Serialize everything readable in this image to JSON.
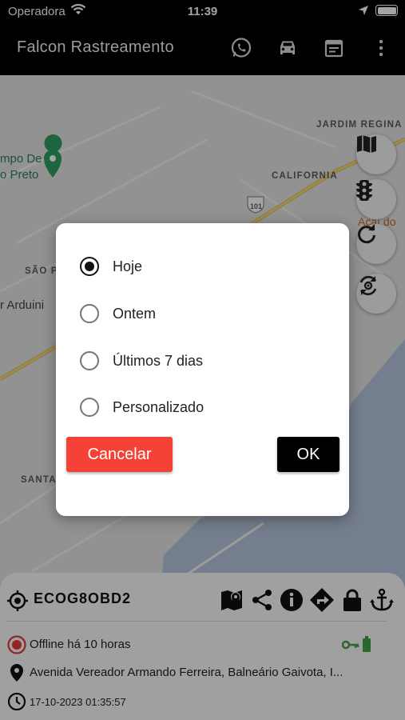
{
  "status_bar": {
    "carrier": "Operadora",
    "time": "11:39"
  },
  "app_bar": {
    "title": "Falcon Rastreamento"
  },
  "map": {
    "labels": [
      "JARDIM REGINA",
      "CALIFORNIA",
      "101",
      "SÃO P",
      "SANTA",
      "mpo De",
      "o Preto",
      "r Arduini",
      "Açaí do"
    ]
  },
  "dialog": {
    "options": [
      {
        "label": "Hoje",
        "selected": true
      },
      {
        "label": "Ontem",
        "selected": false
      },
      {
        "label": "Últimos 7 dias",
        "selected": false
      },
      {
        "label": "Personalizado",
        "selected": false
      }
    ],
    "cancel_label": "Cancelar",
    "ok_label": "OK"
  },
  "vehicle_panel": {
    "plate": "ECOG8OBD2",
    "status": "Offline há 10 horas",
    "address": "Avenida Vereador Armando Ferreira, Balneário Gaivota, I...",
    "datetime": "17-10-2023 01:35:57",
    "colors": {
      "status_red": "#e53935",
      "key_green": "#43a047",
      "accent_cancel": "#f44336"
    }
  }
}
